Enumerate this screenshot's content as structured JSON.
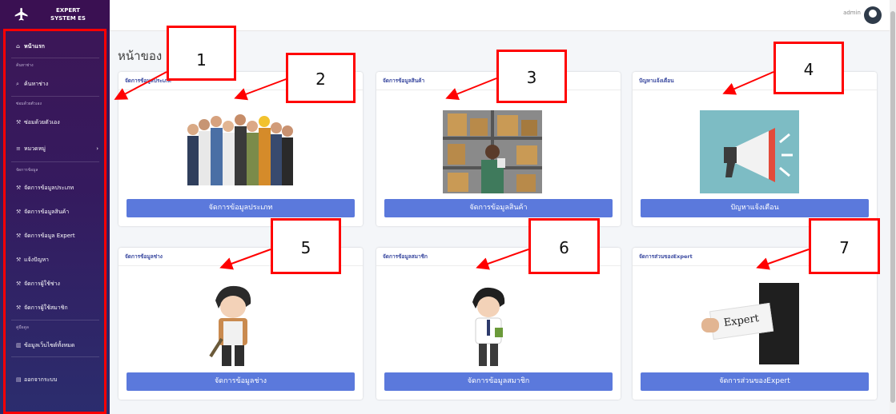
{
  "brand": {
    "line1": "EXPERT",
    "line2": "SYSTEM ES"
  },
  "topbar": {
    "user": "admin"
  },
  "page_title": "หน้าของ",
  "sidebar": {
    "home": "หน้าแรก",
    "sections": [
      {
        "header": "ค้นหาช่าง",
        "items": [
          "ค้นหาช่าง"
        ]
      },
      {
        "header": "ซ่อมด้วยตัวเอง",
        "items": [
          "ซ่อมด้วยตัวเอง",
          "หมวดหมู่"
        ]
      },
      {
        "header": "จัดการข้อมูล",
        "items": [
          "จัดการข้อมูลประเภท",
          "จัดการข้อมูลสินค้า",
          "จัดการข้อมูล Expert",
          "แจ้งปัญหา",
          "จัดการผู้ใช้ช่าง",
          "จัดการผู้ใช้สมาชิก"
        ]
      },
      {
        "header": "คู่มือดูล",
        "items": [
          "ข้อมูลเว็บไซต์ทั้งหมด"
        ]
      },
      {
        "header": "",
        "items": [
          "ออกจากระบบ"
        ]
      }
    ]
  },
  "cards": [
    {
      "title": "จัดการข้อมูลประเภท",
      "button": "จัดการข้อมูลประเภท"
    },
    {
      "title": "จัดการข้อมูลสินค้า",
      "button": "จัดการข้อมูลสินค้า"
    },
    {
      "title": "ปัญหาแจ้งเตือน",
      "button": "ปัญหาแจ้งเตือน"
    },
    {
      "title": "จัดการข้อมูลช่าง",
      "button": "จัดการข้อมูลช่าง"
    },
    {
      "title": "จัดการข้อมูลสมาชิก",
      "button": "จัดการข้อมูลสมาชิก"
    },
    {
      "title": "จัดการส่วนของExpert",
      "button": "จัดการส่วนของExpert"
    }
  ],
  "expert_image_text": "Expert",
  "callouts": [
    "1",
    "2",
    "3",
    "4",
    "5",
    "6",
    "7"
  ],
  "colors": {
    "sidebar_top": "#3d1656",
    "sidebar_bottom": "#2b2d6e",
    "button": "#5b79dc",
    "annotation": "#ff0000"
  }
}
